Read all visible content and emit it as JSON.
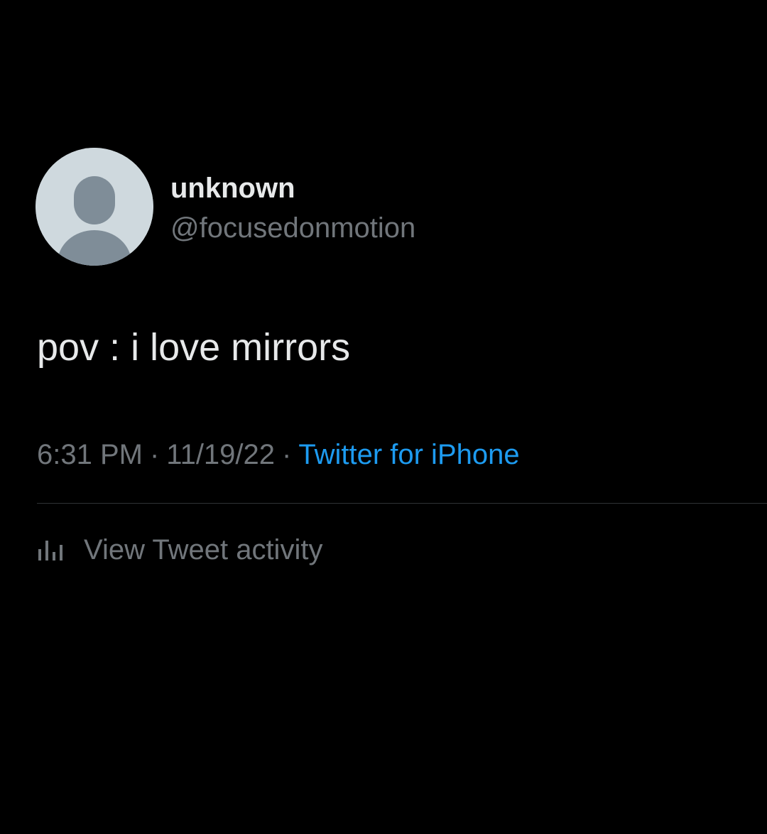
{
  "colors": {
    "background": "#000000",
    "primary_text": "#e7e9ea",
    "secondary_text": "#71767b",
    "link": "#1d9bf0",
    "avatar_bg": "#cfd9de",
    "avatar_figure": "#7f8d98"
  },
  "author": {
    "display_name": "unknown",
    "handle": "@focusedonmotion",
    "avatar_icon": "default-profile-icon"
  },
  "tweet": {
    "text": "pov : i love mirrors",
    "time": "6:31 PM",
    "date": "11/19/22",
    "separator": "·",
    "source": "Twitter for iPhone"
  },
  "activity": {
    "icon": "bar-chart-icon",
    "label": "View Tweet activity"
  }
}
